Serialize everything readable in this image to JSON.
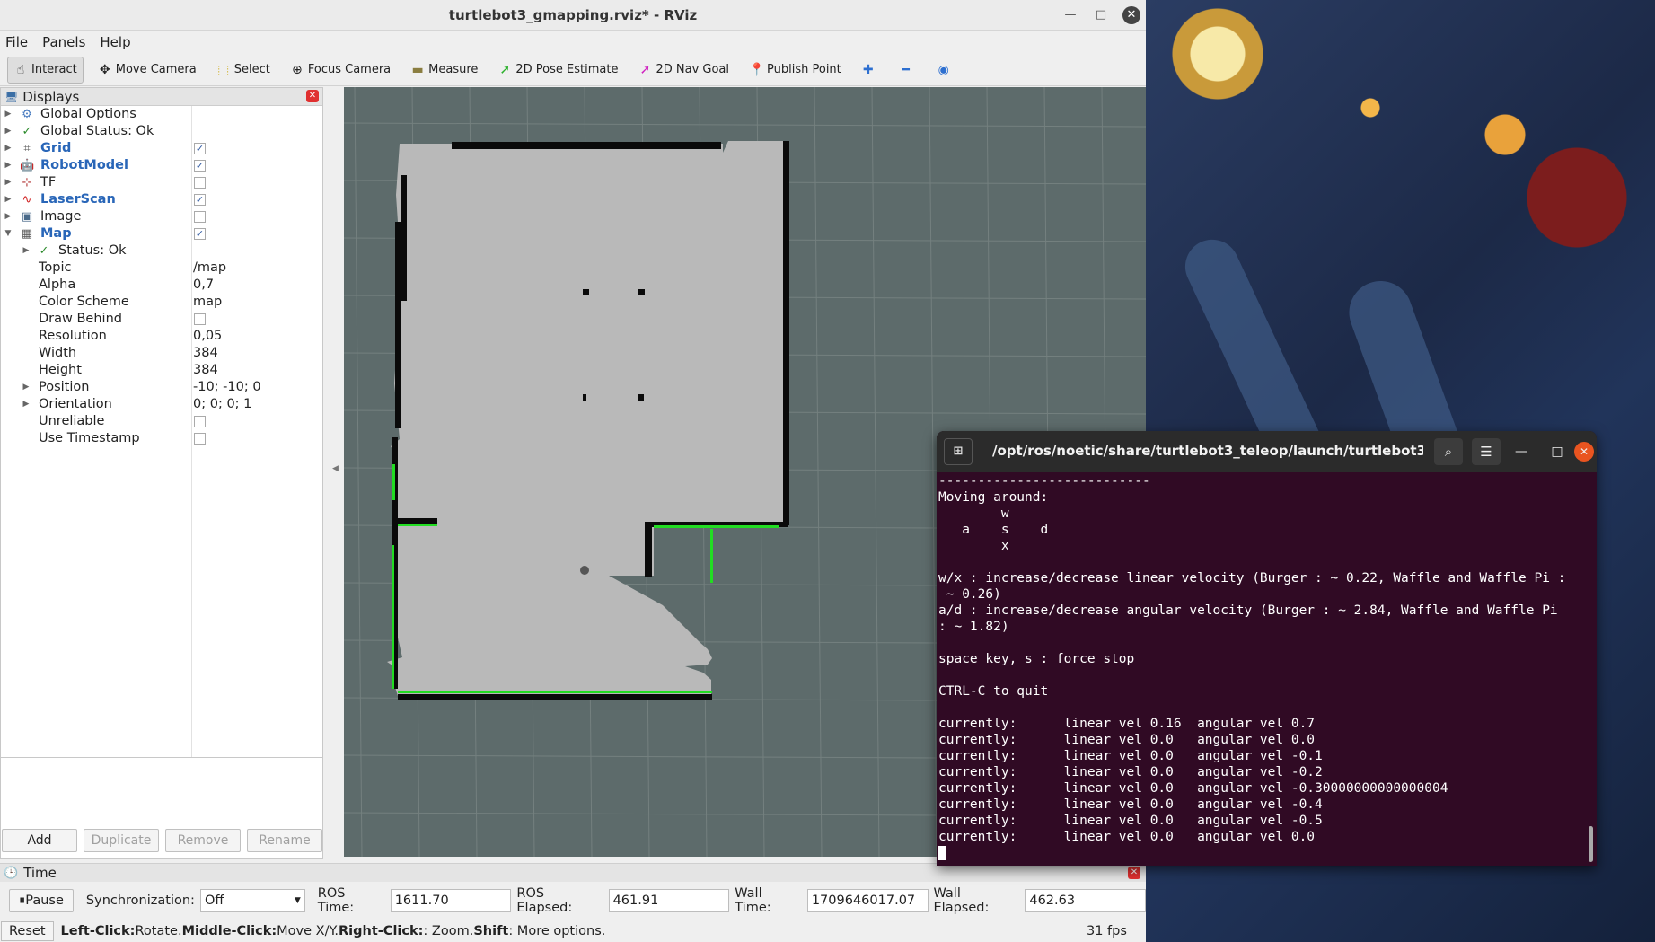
{
  "window": {
    "title": "turtlebot3_gmapping.rviz* - RViz",
    "minimize_glyph": "—",
    "maximize_glyph": "□",
    "close_glyph": "✕"
  },
  "menu": {
    "file": "File",
    "panels": "Panels",
    "help": "Help"
  },
  "toolbar": {
    "interact": "Interact",
    "move_camera": "Move Camera",
    "select": "Select",
    "focus_camera": "Focus Camera",
    "measure": "Measure",
    "pose_estimate": "2D Pose Estimate",
    "nav_goal": "2D Nav Goal",
    "publish_point": "Publish Point"
  },
  "displays": {
    "title": "Displays",
    "close_glyph": "✕",
    "items": {
      "global_options": "Global Options",
      "global_status": "Global Status: Ok",
      "grid": "Grid",
      "robot_model": "RobotModel",
      "tf": "TF",
      "laser_scan": "LaserScan",
      "image": "Image",
      "map": "Map"
    },
    "checks": {
      "grid": true,
      "robot_model": true,
      "tf": false,
      "laser_scan": true,
      "image": false,
      "map": true
    },
    "map_props": {
      "status": "Status: Ok",
      "topic_label": "Topic",
      "topic": "/map",
      "alpha_label": "Alpha",
      "alpha": "0,7",
      "color_scheme_label": "Color Scheme",
      "color_scheme": "map",
      "draw_behind_label": "Draw Behind",
      "resolution_label": "Resolution",
      "resolution": "0,05",
      "width_label": "Width",
      "width": "384",
      "height_label": "Height",
      "height": "384",
      "position_label": "Position",
      "position": "-10; -10; 0",
      "orientation_label": "Orientation",
      "orientation": "0; 0; 0; 1",
      "unreliable_label": "Unreliable",
      "use_timestamp_label": "Use Timestamp"
    },
    "buttons": {
      "add": "Add",
      "duplicate": "Duplicate",
      "remove": "Remove",
      "rename": "Rename"
    }
  },
  "time_panel": {
    "title": "Time",
    "pause": "Pause",
    "sync_label": "Synchronization:",
    "sync_value": "Off",
    "ros_time_label": "ROS Time:",
    "ros_time": "1611.70",
    "ros_elapsed_label": "ROS Elapsed:",
    "ros_elapsed": "461.91",
    "wall_time_label": "Wall Time:",
    "wall_time": "1709646017.07",
    "wall_elapsed_label": "Wall Elapsed:",
    "wall_elapsed": "462.63"
  },
  "status_bar": {
    "reset": "Reset",
    "left_click": "Left-Click:",
    "left_click_desc": " Rotate. ",
    "middle_click": "Middle-Click:",
    "middle_click_desc": " Move X/Y. ",
    "right_click": "Right-Click:",
    "right_click_desc": ": Zoom. ",
    "shift": "Shift",
    "shift_desc": ": More options.",
    "fps": "31 fps"
  },
  "terminal": {
    "title": "/opt/ros/noetic/share/turtlebot3_teleop/launch/turtlebot3...",
    "lines": [
      "---------------------------",
      "Moving around:",
      "        w",
      "   a    s    d",
      "        x",
      "",
      "w/x : increase/decrease linear velocity (Burger : ~ 0.22, Waffle and Waffle Pi :",
      " ~ 0.26)",
      "a/d : increase/decrease angular velocity (Burger : ~ 2.84, Waffle and Waffle Pi",
      ": ~ 1.82)",
      "",
      "space key, s : force stop",
      "",
      "CTRL-C to quit",
      "",
      "currently:      linear vel 0.16  angular vel 0.7",
      "currently:      linear vel 0.0   angular vel 0.0",
      "currently:      linear vel 0.0   angular vel -0.1",
      "currently:      linear vel 0.0   angular vel -0.2",
      "currently:      linear vel 0.0   angular vel -0.30000000000000004",
      "currently:      linear vel 0.0   angular vel -0.4",
      "currently:      linear vel 0.0   angular vel -0.5",
      "currently:      linear vel 0.0   angular vel 0.0"
    ]
  },
  "colors": {
    "view_background": "#5d6b6b",
    "grid_line": "#74807f",
    "map_free": "#b9b9b9",
    "map_wall": "#0a0a0a",
    "laser": "#22dd22",
    "terminal_bg": "#300a24",
    "link_blue": "#2966b8"
  }
}
